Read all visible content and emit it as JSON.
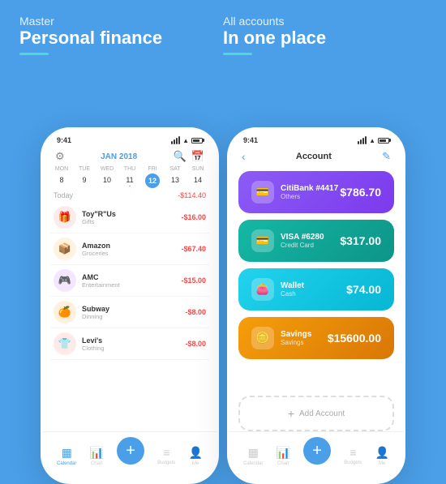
{
  "left_panel": {
    "tagline": "Master",
    "title": "Personal finance"
  },
  "right_panel": {
    "tagline": "All accounts",
    "title": "In one place"
  },
  "left_phone": {
    "status_time": "9:41",
    "header_month": "JAN 2018",
    "calendar": {
      "day_headers": [
        "MON",
        "TUE",
        "WED",
        "THU",
        "FRI",
        "SAT",
        "SUN"
      ],
      "days": [
        "8",
        "9",
        "10",
        "11",
        "12",
        "13",
        "14"
      ],
      "today": "12"
    },
    "today_label": "Today",
    "today_amount": "-$114.40",
    "transactions": [
      {
        "name": "Toy\"R\"Us",
        "category": "Gifts",
        "amount": "-$16.00",
        "icon": "🎁",
        "color": "#FF6B6B"
      },
      {
        "name": "Amazon",
        "category": "Groceries",
        "amount": "-$67.40",
        "icon": "📦",
        "color": "#FFB347"
      },
      {
        "name": "AMC",
        "category": "Entertainment",
        "amount": "-$15.00",
        "icon": "🎮",
        "color": "#DA70D6"
      },
      {
        "name": "Subway",
        "category": "Dinning",
        "amount": "-$8.00",
        "icon": "🍊",
        "color": "#FF8C00"
      },
      {
        "name": "Levi's",
        "category": "Clothing",
        "amount": "-$8.00",
        "icon": "👕",
        "color": "#FF6B6B"
      }
    ],
    "nav_items": [
      {
        "label": "Calendar",
        "icon": "▦",
        "active": true
      },
      {
        "label": "Chart",
        "icon": "📊",
        "active": false
      },
      {
        "label": "",
        "icon": "+",
        "is_plus": true
      },
      {
        "label": "Budgets",
        "icon": "≡",
        "active": false
      },
      {
        "label": "Me",
        "icon": "👤",
        "active": false
      }
    ]
  },
  "right_phone": {
    "status_time": "9:41",
    "header_title": "Account",
    "accounts": [
      {
        "name": "CitiBank #4417",
        "type": "Others",
        "balance": "$786.70",
        "icon": "💳",
        "color_class": "purple"
      },
      {
        "name": "VISA #6280",
        "type": "Credit Card",
        "balance": "$317.00",
        "icon": "💳",
        "color_class": "teal"
      },
      {
        "name": "Wallet",
        "type": "Cash",
        "balance": "$74.00",
        "icon": "👛",
        "color_class": "cyan"
      },
      {
        "name": "Savings",
        "type": "Savings",
        "balance": "$15600.00",
        "icon": "🪙",
        "color_class": "gold"
      }
    ],
    "add_account_label": "Add Account",
    "nav_items": [
      {
        "label": "Calendar",
        "icon": "▦",
        "active": false
      },
      {
        "label": "Chart",
        "icon": "📊",
        "active": false
      },
      {
        "label": "",
        "icon": "+",
        "is_plus": true
      },
      {
        "label": "Budgets",
        "icon": "≡",
        "active": false
      },
      {
        "label": "Me",
        "icon": "👤",
        "active": false
      }
    ]
  }
}
